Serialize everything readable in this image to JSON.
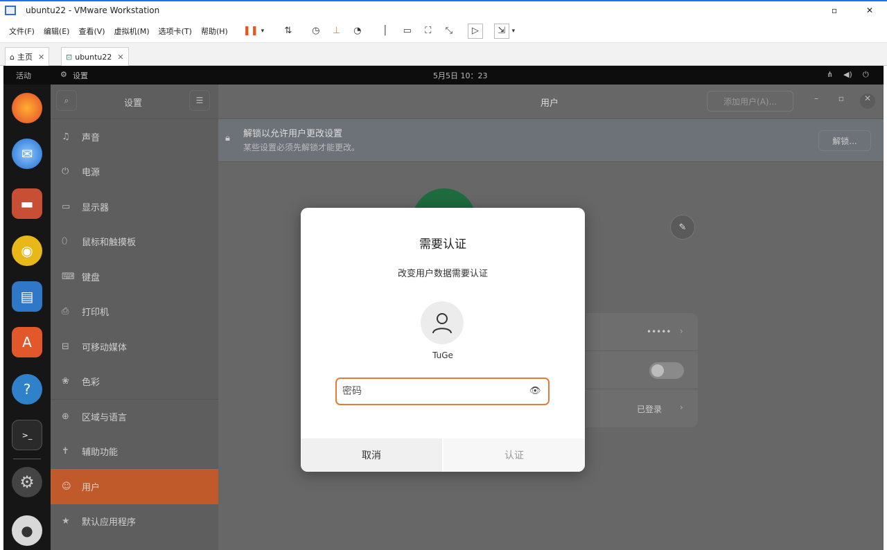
{
  "window": {
    "title": "ubuntu22 - VMware Workstation"
  },
  "menu": {
    "items": [
      "文件(F)",
      "编辑(E)",
      "查看(V)",
      "虚拟机(M)",
      "选项卡(T)",
      "帮助(H)"
    ]
  },
  "tabs": [
    {
      "label": "主页"
    },
    {
      "label": "ubuntu22"
    }
  ],
  "guest_topbar": {
    "activities": "活动",
    "app": "设置",
    "clock": "5月5日 10：23"
  },
  "settings": {
    "sidebar_title": "设置",
    "items": [
      {
        "label": "声音",
        "icon": "speaker-icon"
      },
      {
        "label": "电源",
        "icon": "power-icon"
      },
      {
        "label": "显示器",
        "icon": "monitor-icon"
      },
      {
        "label": "鼠标和触摸板",
        "icon": "mouse-icon"
      },
      {
        "label": "键盘",
        "icon": "keyboard-icon"
      },
      {
        "label": "打印机",
        "icon": "printer-icon"
      },
      {
        "label": "可移动媒体",
        "icon": "media-icon"
      },
      {
        "label": "色彩",
        "icon": "color-icon"
      },
      {
        "label": "区域与语言",
        "icon": "globe-icon"
      },
      {
        "label": "辅助功能",
        "icon": "accessibility-icon"
      },
      {
        "label": "用户",
        "icon": "user-icon"
      },
      {
        "label": "默认应用程序",
        "icon": "star-icon"
      }
    ],
    "active_item": "用户",
    "content_title": "用户",
    "add_user": "添加用户(A)...",
    "banner_title": "解锁以允许用户更改设置",
    "banner_sub": "某些设置必须先解锁才能更改。",
    "unlock": "解锁...",
    "password_dots": "•••••",
    "login_status": "已登录"
  },
  "dialog": {
    "title": "需要认证",
    "subtitle": "改变用户数据需要认证",
    "username": "TuGe",
    "password_placeholder": "密码",
    "cancel": "取消",
    "authenticate": "认证"
  },
  "colors": {
    "accent": "#e6793c",
    "active_sidebar": "#c05a2a",
    "vmware_blue": "#1a73e8"
  }
}
